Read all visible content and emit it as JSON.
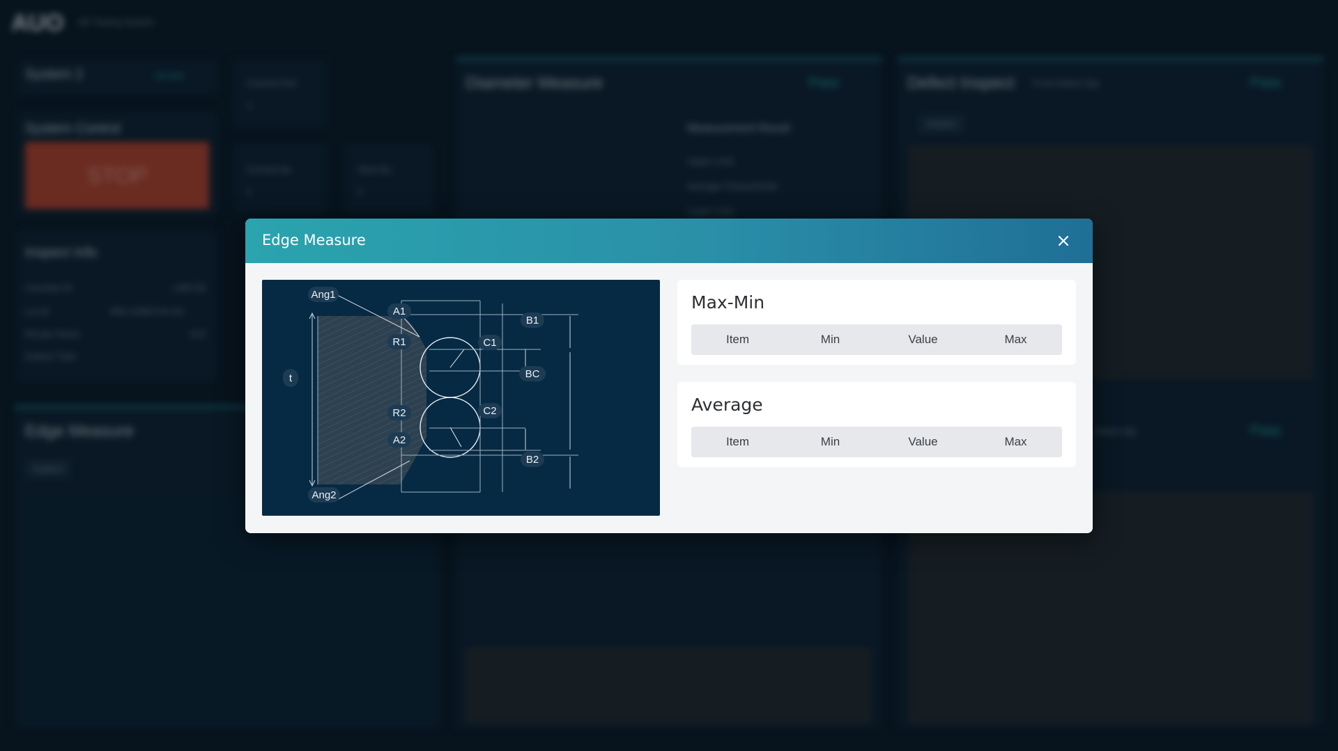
{
  "app": {
    "logo": "AUO",
    "system_name": "AR Testing System"
  },
  "background": {
    "system_card": {
      "title": "System 2",
      "status": "On-line"
    },
    "counters": [
      {
        "label": "Current Pod",
        "value": "1"
      },
      {
        "label": "Current No.",
        "value": "1"
      },
      {
        "label": "Next No.",
        "value": "2"
      }
    ],
    "system_control": {
      "title": "System Control",
      "stop_label": "STOP"
    },
    "inspect_info": {
      "title": "Inspect Info",
      "rows": [
        {
          "label": "Cassette ID",
          "value": "LM0736"
        },
        {
          "label": "Lot ID",
          "value": "999-10960744-4/2"
        },
        {
          "label": "Recipe Name",
          "value": "S10"
        },
        {
          "label": "Inspect Type",
          "value": ""
        }
      ]
    },
    "diameter_measure": {
      "title": "Diameter Measure",
      "status": "Pass",
      "result_title": "Measurement Result",
      "result_rows": [
        "Upper Limit",
        "Average Characteristic",
        "Lower Limit"
      ]
    },
    "defect_inspect": {
      "title": "Defect Inspect",
      "subtitle": "Front Defect Qty",
      "status": "Pass",
      "button": "Inspect"
    },
    "defect_inspect_2": {
      "subtitle": "Defect Qty",
      "status": "Pass"
    },
    "edge_measure": {
      "title": "Edge Measure",
      "button": "Inspect"
    }
  },
  "modal": {
    "title": "Edge Measure",
    "close_icon": "close-icon",
    "diagram_labels": {
      "ang1": "Ang1",
      "ang2": "Ang2",
      "a1": "A1",
      "a2": "A2",
      "r1": "R1",
      "r2": "R2",
      "b1": "B1",
      "b2": "B2",
      "c1": "C1",
      "c2": "C2",
      "bc": "BC",
      "t": "t"
    },
    "max_min": {
      "title": "Max-Min",
      "columns": [
        "Item",
        "Min",
        "Value",
        "Max"
      ]
    },
    "average": {
      "title": "Average",
      "columns": [
        "Item",
        "Min",
        "Value",
        "Max"
      ]
    }
  },
  "colors": {
    "header_gradient_start": "#2aa4ae",
    "header_gradient_end": "#1f6f96",
    "diagram_bg": "#062a44",
    "stop_button": "#c0452e",
    "pass_status": "#26b3ae"
  }
}
